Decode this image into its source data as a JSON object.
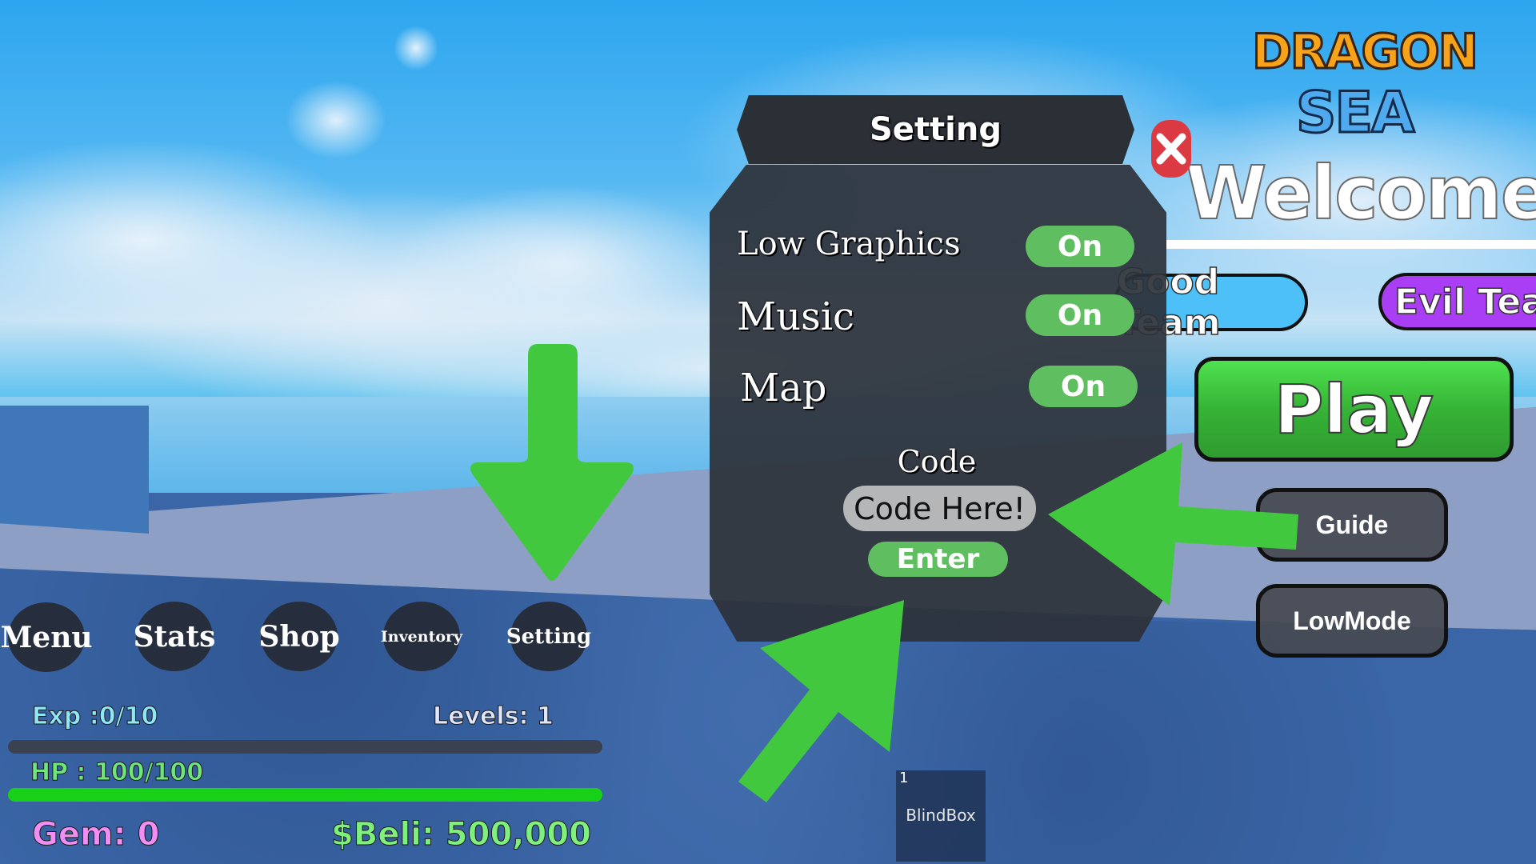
{
  "game": {
    "logo_line1": "DRAGON",
    "logo_line2": "SEA",
    "welcome": "Welcome"
  },
  "settings_panel": {
    "title": "Setting",
    "rows": [
      {
        "label": "Low Graphics",
        "state": "On"
      },
      {
        "label": "Music",
        "state": "On"
      },
      {
        "label": "Map",
        "state": "On"
      }
    ],
    "code_label": "Code",
    "code_input": {
      "value": "",
      "placeholder": "Code Here!"
    },
    "enter_label": "Enter"
  },
  "welcome_menu": {
    "close_icon": "close-x-icon",
    "good_team_label": "Good Team",
    "evil_team_label": "Evil Team",
    "play_label": "Play",
    "guide_label": "Guide",
    "lowmode_label": "LowMode"
  },
  "nav": {
    "items": [
      {
        "label": "Menu"
      },
      {
        "label": "Stats"
      },
      {
        "label": "Shop"
      },
      {
        "label": "Inventory"
      },
      {
        "label": "Setting"
      }
    ]
  },
  "hud": {
    "exp_text": "Exp :0/10",
    "exp_fraction": 0.0,
    "levels_text": "Levels: 1",
    "hp_text": "HP : 100/100",
    "hp_fraction": 1.0,
    "gem_text": "Gem: 0",
    "beli_text": "$Beli: 500,000"
  },
  "hotbar": {
    "slots": [
      {
        "number": "1",
        "label": "BlindBox"
      }
    ]
  },
  "annotations": {
    "arrow_color": "#42c83f",
    "arrows": [
      "arrow-down-to-setting",
      "arrow-left-to-code-input",
      "arrow-up-to-enter"
    ]
  },
  "colors": {
    "toggle_on": "#5fbf60",
    "good_team": "#4dc1f7",
    "evil_team": "#a93ef5",
    "play": "#36b336",
    "close": "#dc3a42"
  }
}
